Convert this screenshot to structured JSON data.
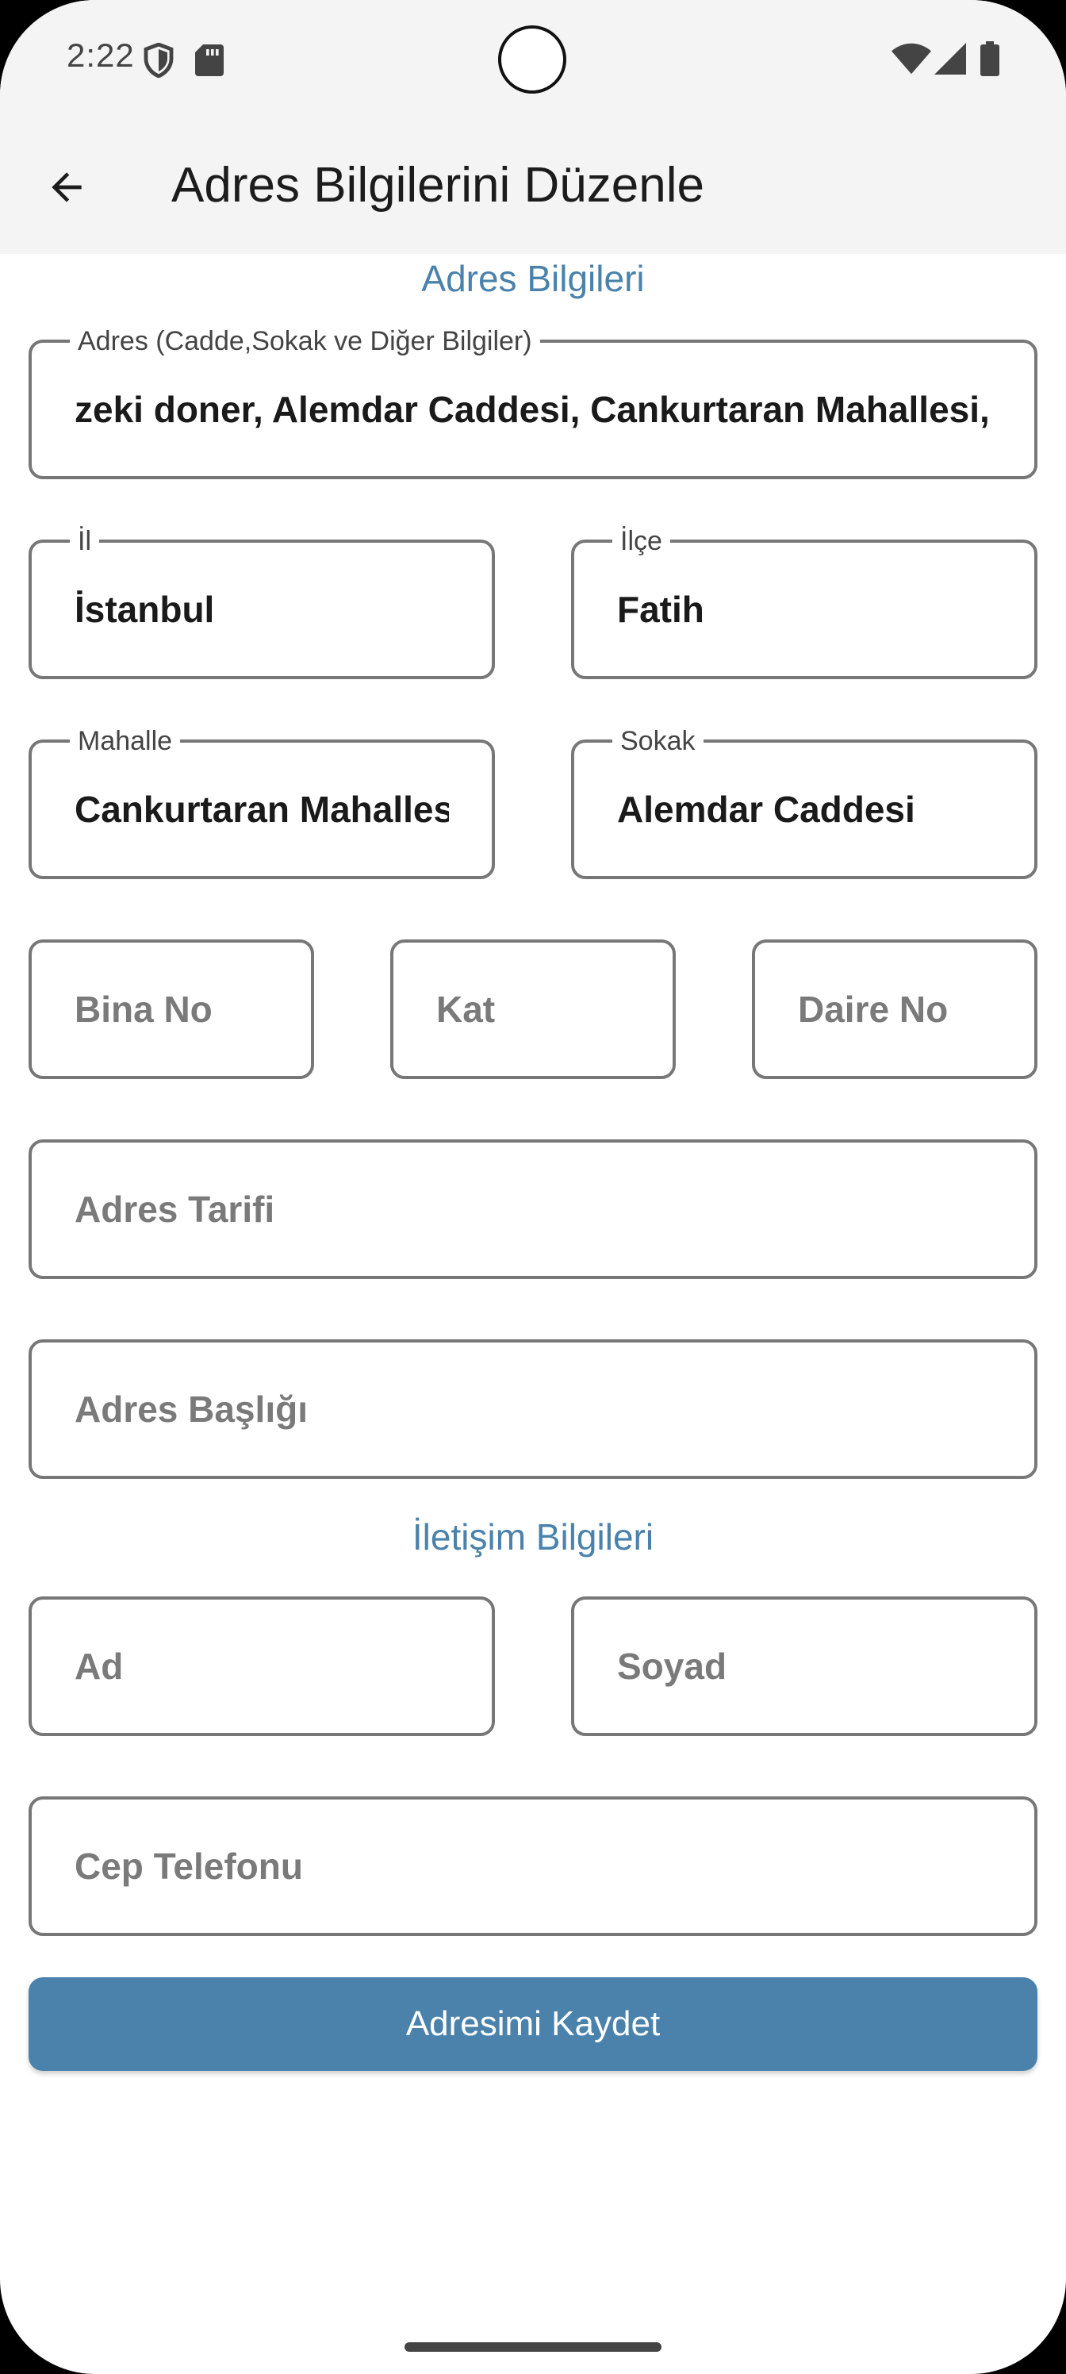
{
  "status_bar": {
    "time": "2:22",
    "icons": [
      "shield-icon",
      "sd-card-icon",
      "wifi-icon",
      "signal-icon",
      "battery-icon"
    ]
  },
  "app_bar": {
    "back_icon": "arrow-back-icon",
    "title": "Adres Bilgilerini Düzenle"
  },
  "address_section": {
    "title": "Adres Bilgileri",
    "address": {
      "label": "Adres (Cadde,Sokak ve Diğer Bilgiler)",
      "value": "zeki doner, Alemdar Caddesi, Cankurtaran Mahallesi,"
    },
    "city": {
      "label": "İl",
      "value": "İstanbul"
    },
    "district": {
      "label": "İlçe",
      "value": "Fatih"
    },
    "neighborhood": {
      "label": "Mahalle",
      "value": "Cankurtaran Mahallesi"
    },
    "street": {
      "label": "Sokak",
      "value": "Alemdar Caddesi"
    },
    "building_no": {
      "placeholder": "Bina No",
      "value": ""
    },
    "floor": {
      "placeholder": "Kat",
      "value": ""
    },
    "apartment_no": {
      "placeholder": "Daire No",
      "value": ""
    },
    "directions": {
      "placeholder": "Adres Tarifi",
      "value": ""
    },
    "address_title": {
      "placeholder": "Adres Başlığı",
      "value": ""
    }
  },
  "contact_section": {
    "title": "İletişim Bilgileri",
    "first_name": {
      "placeholder": "Ad",
      "value": ""
    },
    "last_name": {
      "placeholder": "Soyad",
      "value": ""
    },
    "mobile_phone": {
      "placeholder": "Cep Telefonu",
      "value": ""
    }
  },
  "save_button": {
    "label": "Adresimi Kaydet"
  },
  "colors": {
    "accent": "#4a82ac",
    "field_border": "#777777",
    "app_bar_bg": "#f4f4f4",
    "placeholder_text": "#7a7a7a",
    "value_text": "#1a1a1a"
  }
}
